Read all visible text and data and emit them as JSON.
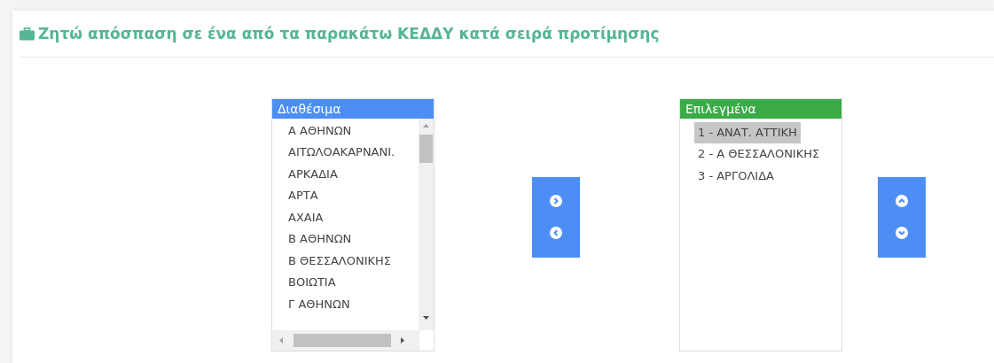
{
  "title": "Ζητώ απόσπαση σε ένα από τα παρακάτω ΚΕΔΔΥ κατά σειρά προτίμησης",
  "available": {
    "header": "Διαθέσιμα",
    "items": [
      {
        "label": "Α ΑΘΗΝΩΝ",
        "selected": false
      },
      {
        "label": "ΑΙΤΩΛΟΑΚΑΡΝΑΝΙ.",
        "selected": false
      },
      {
        "label": "ΑΡΚΑΔΙΑ",
        "selected": false
      },
      {
        "label": "ΑΡΤΑ",
        "selected": false
      },
      {
        "label": "ΑΧΑΙΑ",
        "selected": false
      },
      {
        "label": "Β ΑΘΗΝΩΝ",
        "selected": false
      },
      {
        "label": "Β ΘΕΣΣΑΛΟΝΙΚΗΣ",
        "selected": false
      },
      {
        "label": "ΒΟΙΩΤΙΑ",
        "selected": false
      },
      {
        "label": "Γ ΑΘΗΝΩΝ",
        "selected": false
      }
    ]
  },
  "chosen": {
    "header": "Επιλεγμένα",
    "items": [
      {
        "label": "1 - ΑΝΑΤ. ΑΤΤΙΚΗ",
        "selected": true
      },
      {
        "label": "2 - Α ΘΕΣΣΑΛΟΝΙΚΗΣ",
        "selected": false
      },
      {
        "label": "3 - ΑΡΓΟΛΙΔΑ",
        "selected": false
      }
    ]
  }
}
